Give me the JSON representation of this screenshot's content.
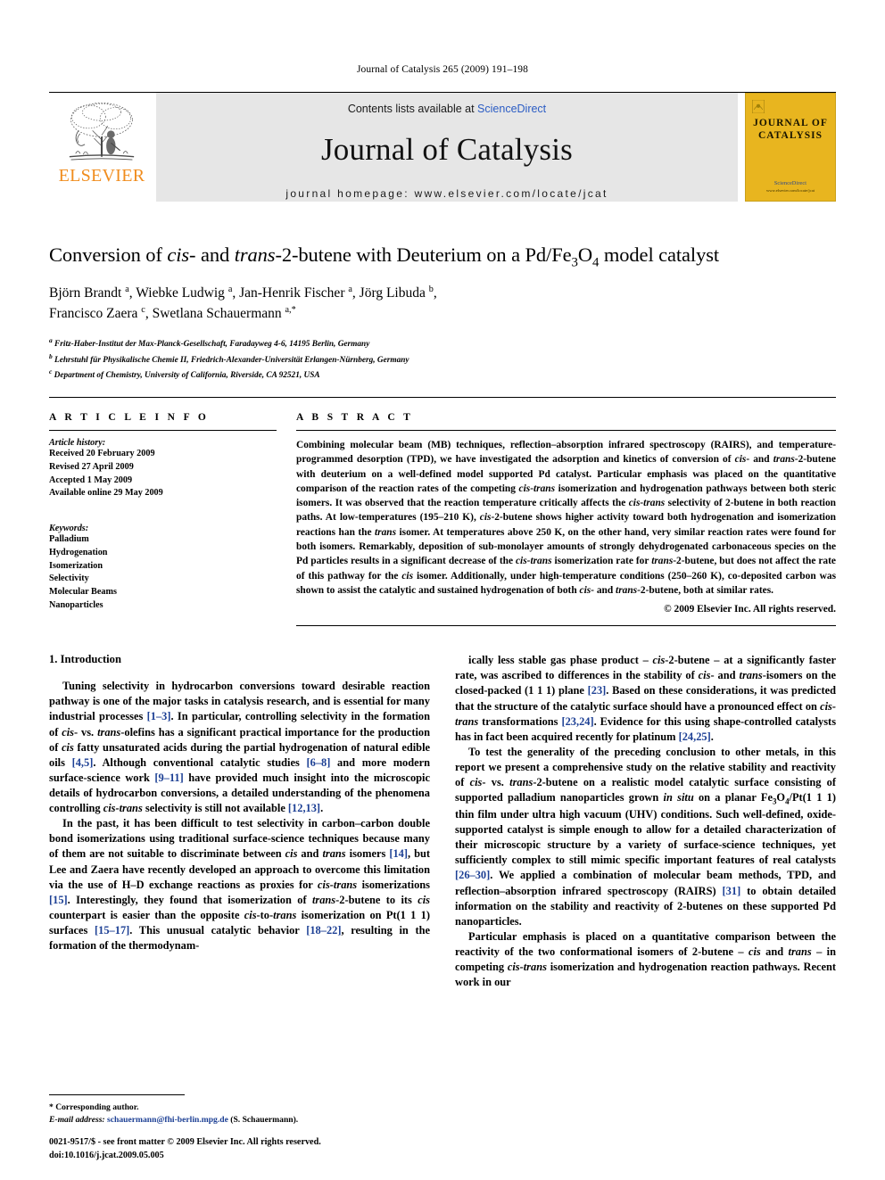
{
  "running_head": "Journal of Catalysis 265 (2009) 191–198",
  "masthead": {
    "publisher_name": "ELSEVIER",
    "contents_prefix": "Contents lists available at ",
    "sciencedirect": "ScienceDirect",
    "journal_name": "Journal of Catalysis",
    "homepage": "journal homepage: www.elsevier.com/locate/jcat",
    "cover_title_line1": "JOURNAL OF",
    "cover_title_line2": "CATALYSIS",
    "cover_footer_sd": "ScienceDirect",
    "cover_footer_note": "www.elsevier.com/locate/jcat",
    "accent_orange": "#F08C1D",
    "cover_yellow": "#E8B51F",
    "link_blue": "#2b5cc4"
  },
  "article": {
    "title_html": "Conversion of <i>cis</i>- and <i>trans</i>-2-butene with Deuterium on a Pd/Fe<sub>3</sub>O<sub>4</sub> model catalyst",
    "authors_html": "Björn Brandt <sup>a</sup>, Wiebke Ludwig <sup>a</sup>, Jan-Henrik Fischer <sup>a</sup>, Jörg Libuda <sup>b</sup>,<br>Francisco Zaera <sup>c</sup>, Swetlana Schauermann <sup>a,</sup><sup>*</sup>",
    "affiliations": [
      "<sup>a</sup> Fritz-Haber-Institut der Max-Planck-Gesellschaft, Faradayweg 4-6, 14195 Berlin, Germany",
      "<sup>b</sup> Lehrstuhl für Physikalische Chemie II, Friedrich-Alexander-Universität Erlangen-Nürnberg, Germany",
      "<sup>c</sup> Department of Chemistry, University of California, Riverside, CA 92521, USA"
    ]
  },
  "article_info": {
    "heading": "A R T I C L E   I N F O",
    "history_label": "Article history:",
    "history": [
      "Received 20 February 2009",
      "Revised 27 April 2009",
      "Accepted 1 May 2009",
      "Available online 29 May 2009"
    ],
    "keywords_label": "Keywords:",
    "keywords": [
      "Palladium",
      "Hydrogenation",
      "Isomerization",
      "Selectivity",
      "Molecular Beams",
      "Nanoparticles"
    ]
  },
  "abstract": {
    "heading": "A B S T R A C T",
    "text_html": "Combining molecular beam (MB) techniques, reflection–absorption infrared spectroscopy (RAIRS), and temperature-programmed desorption (TPD), we have investigated the adsorption and kinetics of conversion of <i>cis</i>- and <i>trans</i>-2-butene with deuterium on a well-defined model supported Pd catalyst. Particular emphasis was placed on the quantitative comparison of the reaction rates of the competing <i>cis-trans</i> isomerization and hydrogenation pathways between both steric isomers. It was observed that the reaction temperature critically affects the <i>cis-trans</i> selectivity of 2-butene in both reaction paths. At low-temperatures (195–210 K), <i>cis</i>-2-butene shows higher activity toward both hydrogenation and isomerization reactions han the <i>trans</i> isomer. At temperatures above 250 K, on the other hand, very similar reaction rates were found for both isomers. Remarkably, deposition of sub-monolayer amounts of strongly dehydrogenated carbonaceous species on the Pd particles results in a significant decrease of the <i>cis-trans</i> isomerization rate for <i>trans</i>-2-butene, but does not affect the rate of this pathway for the <i>cis</i> isomer. Additionally, under high-temperature conditions (250–260 K), co-deposited carbon was shown to assist the catalytic and sustained hydrogenation of both <i>cis</i>- and <i>trans</i>-2-butene, both at similar rates.",
    "copyright": "© 2009 Elsevier Inc. All rights reserved."
  },
  "body": {
    "section_title": "1. Introduction",
    "left_paragraphs_html": [
      "Tuning selectivity in hydrocarbon conversions toward desirable reaction pathway is one of the major tasks in catalysis research, and is essential for many industrial processes <span class=\"ref\">[1–3]</span>. In particular, controlling selectivity in the formation of <i>cis</i>- vs. <i>trans</i>-olefins has a significant practical importance for the production of <i>cis</i> fatty unsaturated acids during the partial hydrogenation of natural edible oils <span class=\"ref\">[4,5]</span>. Although conventional catalytic studies <span class=\"ref\">[6–8]</span> and more modern surface-science work <span class=\"ref\">[9–11]</span> have provided much insight into the microscopic details of hydrocarbon conversions, a detailed understanding of the phenomena controlling <i>cis-trans</i> selectivity is still not available <span class=\"ref\">[12,13]</span>.",
      "In the past, it has been difficult to test selectivity in carbon–carbon double bond isomerizations using traditional surface-science techniques because many of them are not suitable to discriminate between <i>cis</i> and <i>trans</i> isomers <span class=\"ref\">[14]</span>, but Lee and Zaera have recently developed an approach to overcome this limitation via the use of H–D exchange reactions as proxies for <i>cis-trans</i> isomerizations <span class=\"ref\">[15]</span>. Interestingly, they found that isomerization of <i>trans</i>-2-butene to its <i>cis</i> counterpart is easier than the opposite <i>cis</i>-to-<i>trans</i> isomerization on Pt(1 1 1) surfaces <span class=\"ref\">[15–17]</span>. This unusual catalytic behavior <span class=\"ref\">[18–22]</span>, resulting in the formation of the thermodynam-"
    ],
    "right_paragraphs_html": [
      "ically less stable gas phase product – <i>cis</i>-2-butene – at a significantly faster rate, was ascribed to differences in the stability of <i>cis</i>- and <i>trans</i>-isomers on the closed-packed (1 1 1) plane <span class=\"ref\">[23]</span>. Based on these considerations, it was predicted that the structure of the catalytic surface should have a pronounced effect on <i>cis-trans</i> transformations <span class=\"ref\">[23,24]</span>. Evidence for this using shape-controlled catalysts has in fact been acquired recently for platinum <span class=\"ref\">[24,25]</span>.",
      "To test the generality of the preceding conclusion to other metals, in this report we present a comprehensive study on the relative stability and reactivity of <i>cis</i>- vs. <i>trans</i>-2-butene on a realistic model catalytic surface consisting of supported palladium nanoparticles grown <i>in situ</i> on a planar Fe<sub>3</sub>O<sub>4</sub>/Pt(1 1 1) thin film under ultra high vacuum (UHV) conditions. Such well-defined, oxide-supported catalyst is simple enough to allow for a detailed characterization of their microscopic structure by a variety of surface-science techniques, yet sufficiently complex to still mimic specific important features of real catalysts <span class=\"ref\">[26–30]</span>. We applied a combination of molecular beam methods, TPD, and reflection–absorption infrared spectroscopy (RAIRS) <span class=\"ref\">[31]</span> to obtain detailed information on the stability and reactivity of 2-butenes on these supported Pd nanoparticles.",
      "Particular emphasis is placed on a quantitative comparison between the reactivity of the two conformational isomers of 2-butene – <i>cis</i> and <i>trans</i> – in competing <i>cis-trans</i> isomerization and hydrogenation reaction pathways. Recent work in our"
    ]
  },
  "footnotes": {
    "corresponding": "* Corresponding author.",
    "email_label": "E-mail address:",
    "email": "schauermann@fhi-berlin.mpg.de",
    "email_suffix": "(S. Schauermann).",
    "issn_line": "0021-9517/$ - see front matter © 2009 Elsevier Inc. All rights reserved.",
    "doi_line": "doi:10.1016/j.jcat.2009.05.005"
  }
}
